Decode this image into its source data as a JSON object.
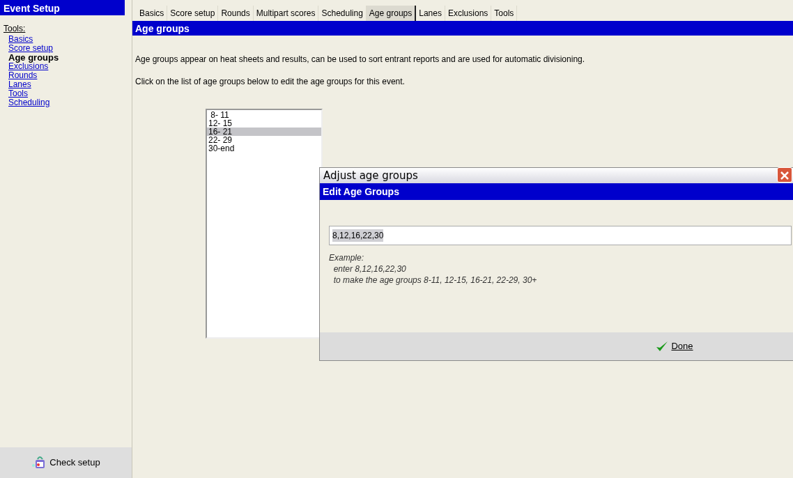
{
  "sidebar": {
    "title": "Event Setup",
    "heading": "Tools:",
    "items": [
      {
        "label": "Basics",
        "selected": false
      },
      {
        "label": "Score setup",
        "selected": false
      },
      {
        "label": "Age groups",
        "selected": true
      },
      {
        "label": "Exclusions",
        "selected": false
      },
      {
        "label": "Rounds",
        "selected": false
      },
      {
        "label": "Lanes",
        "selected": false
      },
      {
        "label": "Tools",
        "selected": false
      },
      {
        "label": "Scheduling",
        "selected": false
      }
    ],
    "footer_button": "Check setup"
  },
  "tabs": [
    {
      "label": "Basics",
      "selected": false
    },
    {
      "label": "Score setup",
      "selected": false
    },
    {
      "label": "Rounds",
      "selected": false
    },
    {
      "label": "Multipart scores",
      "selected": false
    },
    {
      "label": "Scheduling",
      "selected": false
    },
    {
      "label": "Age groups",
      "selected": true
    },
    {
      "label": "Lanes",
      "selected": false
    },
    {
      "label": "Exclusions",
      "selected": false
    },
    {
      "label": "Tools",
      "selected": false
    }
  ],
  "section_title": "Age groups",
  "paragraphs": [
    "Age groups appear on heat sheets and results, can be used to sort entrant reports and are used for automatic divisioning.",
    "Click on the list of age groups below to edit the age groups for this event."
  ],
  "age_list": [
    {
      "label": " 8- 11",
      "selected": false
    },
    {
      "label": "12- 15",
      "selected": false
    },
    {
      "label": "16- 21",
      "selected": true
    },
    {
      "label": "22- 29",
      "selected": false
    },
    {
      "label": "30-end",
      "selected": false
    }
  ],
  "dialog": {
    "title": "Adjust age groups",
    "header": "Edit Age Groups",
    "field_value": "8,12,16,22,30",
    "example_lines": [
      "Example:",
      "  enter 8,12,16,22,30",
      "  to make the age groups 8-11, 12-15, 16-21, 22-29, 30+"
    ],
    "button": "Done"
  }
}
